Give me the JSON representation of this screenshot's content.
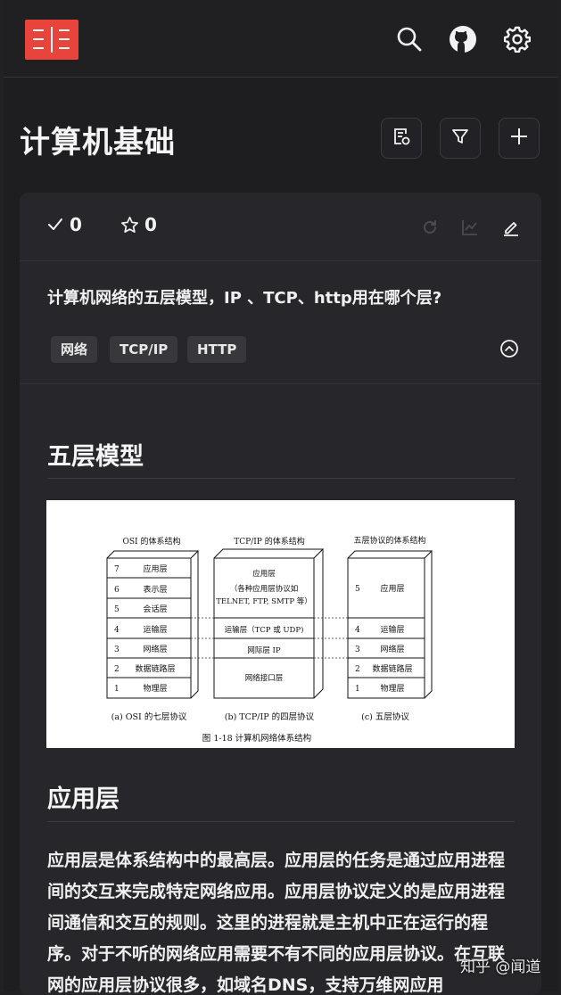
{
  "page": {
    "title": "计算机基础"
  },
  "header": {
    "icons": [
      "logo-icon",
      "search-icon",
      "github-icon",
      "gear-icon"
    ]
  },
  "toolbar": {
    "icons": [
      "note-icon",
      "filter-icon",
      "plus-icon"
    ]
  },
  "card": {
    "correct_count": "0",
    "star_count": "0",
    "question": "计算机网络的五层模型，IP 、TCP、http用在哪个层?",
    "tags": [
      "网络",
      "TCP/IP",
      "HTTP"
    ],
    "section1_heading": "五层模型",
    "section2_heading": "应用层",
    "paragraph": "应用层是体系结构中的最高层。应用层的任务是通过应用进程间的交互来完成特定网络应用。应用层协议定义的是应用进程间通信和交互的规则。这里的进程就是主机中正在运行的程序。对于不听的网络应用需要不有不同的应用层协议。在互联网的应用层协议很多，如域名DNS，支持万维网应用"
  },
  "figure": {
    "osi_title": "OSI 的体系结构",
    "tcpip_title": "TCP/IP 的体系结构",
    "five_title": "五层协议的体系结构",
    "osi_layers": [
      {
        "num": "7",
        "name": "应用层"
      },
      {
        "num": "6",
        "name": "表示层"
      },
      {
        "num": "5",
        "name": "会话层"
      },
      {
        "num": "4",
        "name": "运输层"
      },
      {
        "num": "3",
        "name": "网络层"
      },
      {
        "num": "2",
        "name": "数据链路层"
      },
      {
        "num": "1",
        "name": "物理层"
      }
    ],
    "tcpip_app_lines": [
      "应用层",
      "（各种应用层协议如",
      "TELNET, FTP, SMTP 等）"
    ],
    "tcpip_transport": "运输层（TCP 或 UDP)",
    "tcpip_internet": "网际层 IP",
    "tcpip_link": "网络接口层",
    "five_layers": [
      {
        "num": "5",
        "name": "应用层"
      },
      {
        "num": "4",
        "name": "运输层"
      },
      {
        "num": "3",
        "name": "网络层"
      },
      {
        "num": "2",
        "name": "数据链路层"
      },
      {
        "num": "1",
        "name": "物理层"
      }
    ],
    "caption_a": "(a) OSI 的七层协议",
    "caption_b": "(b) TCP/IP 的四层协议",
    "caption_c": "(c) 五层协议",
    "figure_caption": "图 1-18   计算机网络体系结构"
  },
  "watermark": "知乎 @闻道",
  "colors": {
    "brand": "#e8443b",
    "background": "#1e1e20",
    "card": "#27272b"
  }
}
